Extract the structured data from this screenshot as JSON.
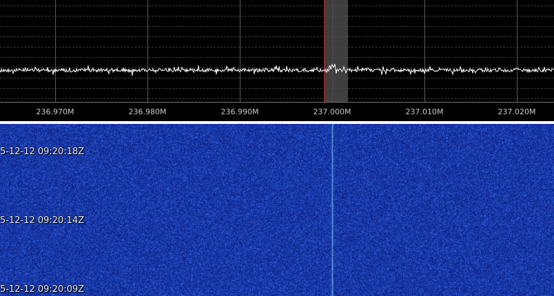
{
  "spectrum": {
    "grid_color": "#3c3c3c",
    "trace_color": "#ffffff",
    "center_marker_color": "#d01818",
    "passband_color": "#4a4a4a"
  },
  "axis": {
    "labels": [
      "236.970M",
      "236.980M",
      "236.990M",
      "237.000M",
      "237.010M",
      "237.020M"
    ]
  },
  "waterfall": {
    "base_color": "#1436b4",
    "timestamps": [
      "5-12-12 09:20:18Z",
      "5-12-12 09:20:14Z",
      "5-12-12 09:20:09Z"
    ]
  }
}
